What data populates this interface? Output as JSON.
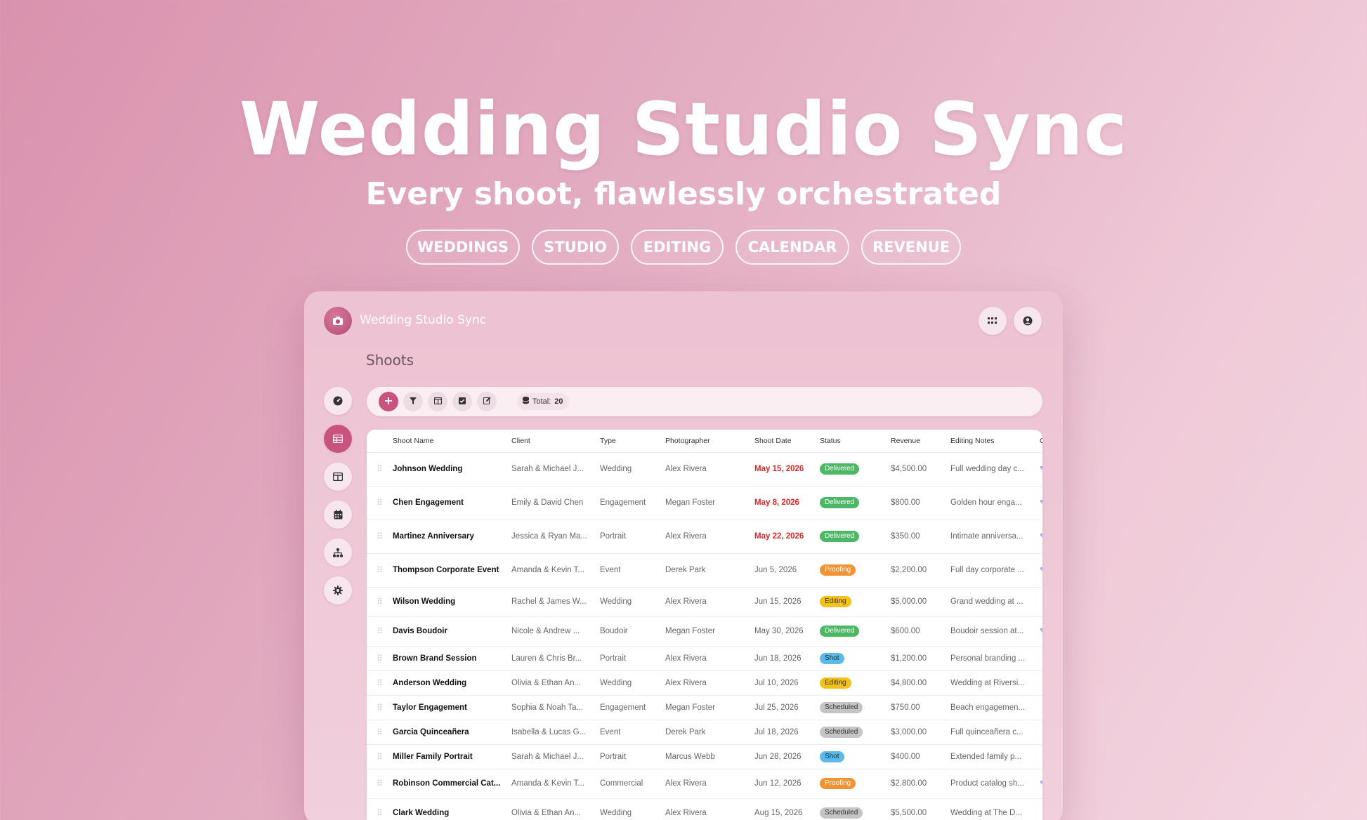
{
  "hero": {
    "title": "Wedding Studio Sync",
    "subtitle": "Every shoot, flawlessly orchestrated",
    "pills": [
      "WEDDINGS",
      "STUDIO",
      "EDITING",
      "CALENDAR",
      "REVENUE"
    ]
  },
  "app": {
    "title": "Wedding Studio Sync",
    "page_title": "Shoots",
    "icons": {
      "logo": "camera-icon",
      "apps": "grid-icon",
      "account": "user-circle-icon"
    }
  },
  "sidebar": {
    "items": [
      {
        "icon": "dashboard-icon",
        "active": false
      },
      {
        "icon": "table-icon",
        "active": true
      },
      {
        "icon": "board-icon",
        "active": false
      },
      {
        "icon": "calendar-icon",
        "active": false
      },
      {
        "icon": "hierarchy-icon",
        "active": false
      },
      {
        "icon": "settings-icon",
        "active": false
      }
    ]
  },
  "toolbar": {
    "total_label": "Total:",
    "total_value": "20",
    "icons": [
      "plus-icon",
      "filter-icon",
      "columns-icon",
      "checkbox-icon",
      "edit-icon",
      "database-icon"
    ]
  },
  "table": {
    "columns": [
      "Shoot Name",
      "Client",
      "Type",
      "Photographer",
      "Shoot Date",
      "Status",
      "Revenue",
      "Editing Notes",
      "G"
    ],
    "rows": [
      {
        "name": "Johnson Wedding",
        "client": "Sarah & Michael J...",
        "type": "Wedding",
        "photographer": "Alex Rivera",
        "date": "May 15, 2026",
        "date_overdue": true,
        "status": "Delivered",
        "revenue": "$4,500.00",
        "notes": "Full wedding day c...",
        "extra": "✎"
      },
      {
        "name": "Chen Engagement",
        "client": "Emily & David Chen",
        "type": "Engagement",
        "photographer": "Megan Foster",
        "date": "May 8, 2026",
        "date_overdue": true,
        "status": "Delivered",
        "revenue": "$800.00",
        "notes": "Golden hour enga...",
        "extra": "✎"
      },
      {
        "name": "Martinez Anniversary",
        "client": "Jessica & Ryan Ma...",
        "type": "Portrait",
        "photographer": "Alex Rivera",
        "date": "May 22, 2026",
        "date_overdue": true,
        "status": "Delivered",
        "revenue": "$350.00",
        "notes": "Intimate anniversa...",
        "extra": "✎"
      },
      {
        "name": "Thompson Corporate Event",
        "client": "Amanda & Kevin T...",
        "type": "Event",
        "photographer": "Derek Park",
        "date": "Jun 5, 2026",
        "date_overdue": false,
        "status": "Proofing",
        "revenue": "$2,200.00",
        "notes": "Full day corporate ...",
        "extra": "✎"
      },
      {
        "name": "Wilson Wedding",
        "client": "Rachel & James W...",
        "type": "Wedding",
        "photographer": "Alex Rivera",
        "date": "Jun 15, 2026",
        "date_overdue": false,
        "status": "Editing",
        "revenue": "$5,000.00",
        "notes": "Grand wedding at ...",
        "extra": ""
      },
      {
        "name": "Davis Boudoir",
        "client": "Nicole & Andrew ...",
        "type": "Boudoir",
        "photographer": "Megan Foster",
        "date": "May 30, 2026",
        "date_overdue": false,
        "status": "Delivered",
        "revenue": "$600.00",
        "notes": "Boudoir session at...",
        "extra": "✎"
      },
      {
        "name": "Brown Brand Session",
        "client": "Lauren & Chris Br...",
        "type": "Portrait",
        "photographer": "Alex Rivera",
        "date": "Jun 18, 2026",
        "date_overdue": false,
        "status": "Shot",
        "revenue": "$1,200.00",
        "notes": "Personal branding ...",
        "extra": ""
      },
      {
        "name": "Anderson Wedding",
        "client": "Olivia & Ethan An...",
        "type": "Wedding",
        "photographer": "Alex Rivera",
        "date": "Jul 10, 2026",
        "date_overdue": false,
        "status": "Editing",
        "revenue": "$4,800.00",
        "notes": "Wedding at Riversi...",
        "extra": ""
      },
      {
        "name": "Taylor Engagement",
        "client": "Sophia & Noah Ta...",
        "type": "Engagement",
        "photographer": "Megan Foster",
        "date": "Jul 25, 2026",
        "date_overdue": false,
        "status": "Scheduled",
        "revenue": "$750.00",
        "notes": "Beach engagemen...",
        "extra": ""
      },
      {
        "name": "Garcia Quinceañera",
        "client": "Isabella & Lucas G...",
        "type": "Event",
        "photographer": "Derek Park",
        "date": "Jul 18, 2026",
        "date_overdue": false,
        "status": "Scheduled",
        "revenue": "$3,000.00",
        "notes": "Full quinceañera c...",
        "extra": ""
      },
      {
        "name": "Miller Family Portrait",
        "client": "Sarah & Michael J...",
        "type": "Portrait",
        "photographer": "Marcus Webb",
        "date": "Jun 28, 2026",
        "date_overdue": false,
        "status": "Shot",
        "revenue": "$400.00",
        "notes": "Extended family p...",
        "extra": ""
      },
      {
        "name": "Robinson Commercial Cat...",
        "client": "Amanda & Kevin T...",
        "type": "Commercial",
        "photographer": "Alex Rivera",
        "date": "Jun 12, 2026",
        "date_overdue": false,
        "status": "Proofing",
        "revenue": "$2,800.00",
        "notes": "Product catalog sh...",
        "extra": "✎"
      },
      {
        "name": "Clark Wedding",
        "client": "Olivia & Ethan An...",
        "type": "Wedding",
        "photographer": "Alex Rivera",
        "date": "Aug 15, 2026",
        "date_overdue": false,
        "status": "Scheduled",
        "revenue": "$5,500.00",
        "notes": "Wedding at The D...",
        "extra": ""
      }
    ]
  }
}
